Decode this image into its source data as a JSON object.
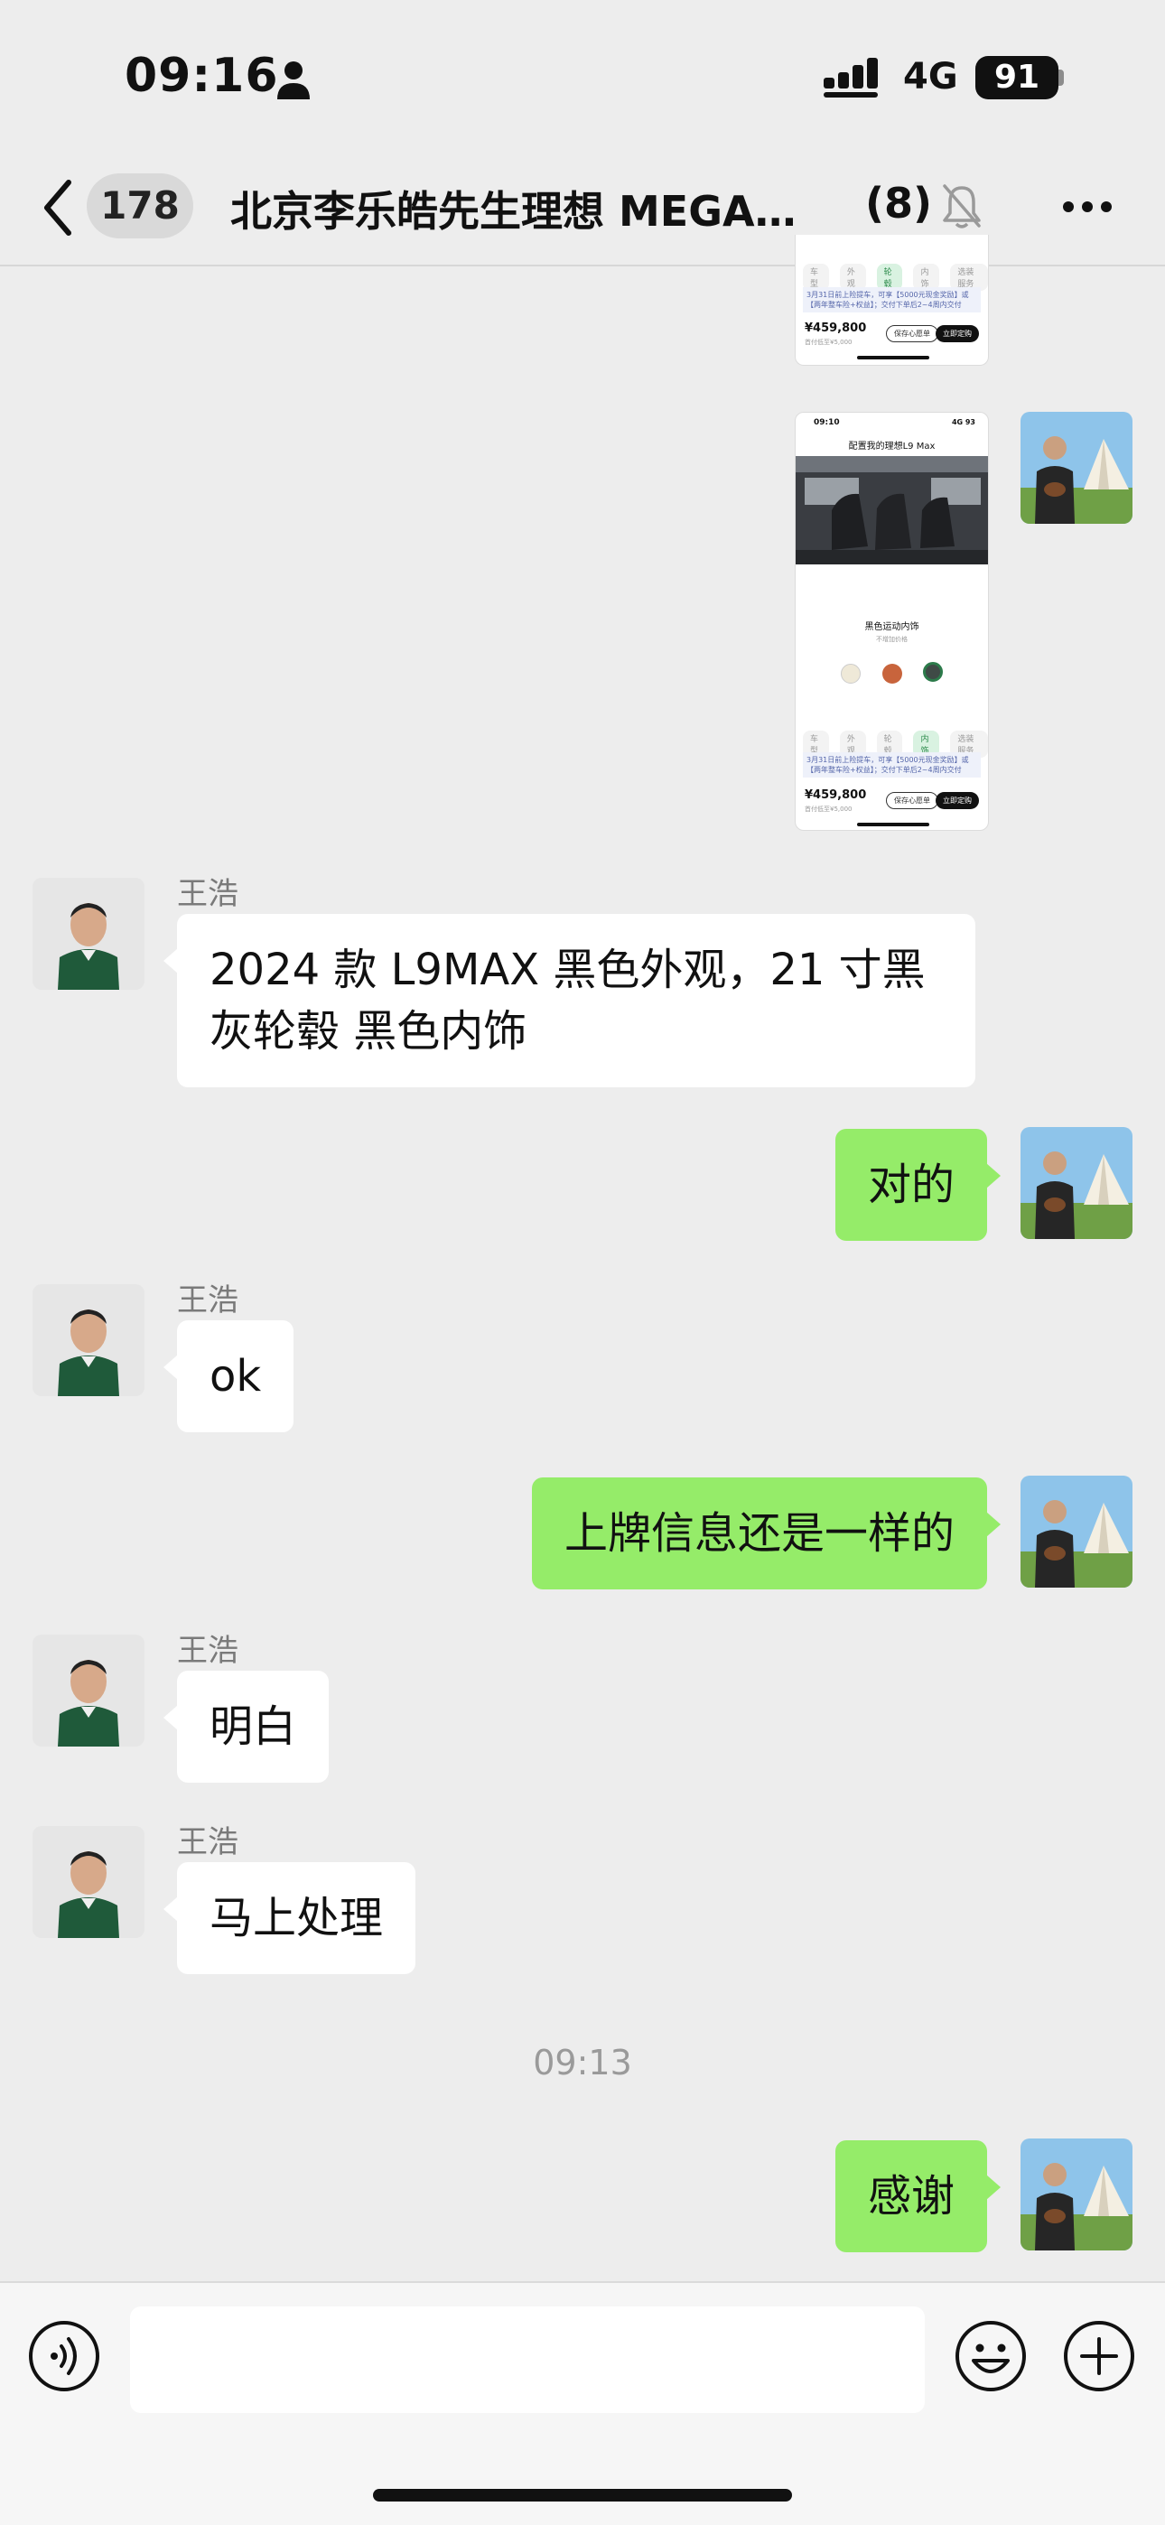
{
  "status_bar": {
    "time": "09:16",
    "network": "4G",
    "battery": "91"
  },
  "nav": {
    "unread_count": "178",
    "title": "北京李乐皓先生理想 MEGA…",
    "member_count": "(8)"
  },
  "thumb_top": {
    "tabs": [
      "车型",
      "外观",
      "轮毂",
      "内饰",
      "选装服务"
    ],
    "active_tab": 2,
    "notice": "3月31日前上险提车，可享【5000元现金奖励】或【两年整车险+权益】；交付下单后2~4周内交付",
    "price": "¥459,800",
    "sub_price": "首付低至¥5,000",
    "save_label": "保存心愿单",
    "order_label": "立即定购"
  },
  "thumb_bottom": {
    "status_time": "09:10",
    "status_right": "4G 93",
    "title": "配置我的理想L9 Max",
    "interior_label": "黑色运动内饰",
    "interior_sub": "不增加价格",
    "swatch_colors": [
      "#efe9d8",
      "#c8643c",
      "#3f4a46"
    ],
    "tabs": [
      "车型",
      "外观",
      "轮毂",
      "内饰",
      "选装服务"
    ],
    "active_tab": 3,
    "notice": "3月31日前上险提车，可享【5000元现金奖励】或【两年整车险+权益】；交付下单后2~4周内交付",
    "price": "¥459,800",
    "sub_price": "首付低至¥5,000",
    "save_label": "保存心愿单",
    "order_label": "立即定购"
  },
  "messages": [
    {
      "sender": "王浩",
      "direction": "in",
      "text": "2024 款 L9MAX  黑色外观，21 寸黑灰轮毂 黑色内饰"
    },
    {
      "direction": "out",
      "text": "对的"
    },
    {
      "sender": "王浩",
      "direction": "in",
      "text": "ok"
    },
    {
      "direction": "out",
      "text": "上牌信息还是一样的"
    },
    {
      "sender": "王浩",
      "direction": "in",
      "text": "明白"
    },
    {
      "sender": "王浩",
      "direction": "in",
      "text": "马上处理"
    },
    {
      "timestamp": "09:13"
    },
    {
      "direction": "out",
      "text": "感谢"
    }
  ],
  "icons": {
    "back": "chevron-left-icon",
    "mute": "bell-slash-icon",
    "more": "ellipsis-icon",
    "voice": "voice-icon",
    "emoji": "emoji-icon",
    "plus": "plus-icon"
  },
  "colors": {
    "outgoing_bubble": "#95ec69",
    "incoming_bubble": "#ffffff",
    "chat_background": "#ededed"
  }
}
